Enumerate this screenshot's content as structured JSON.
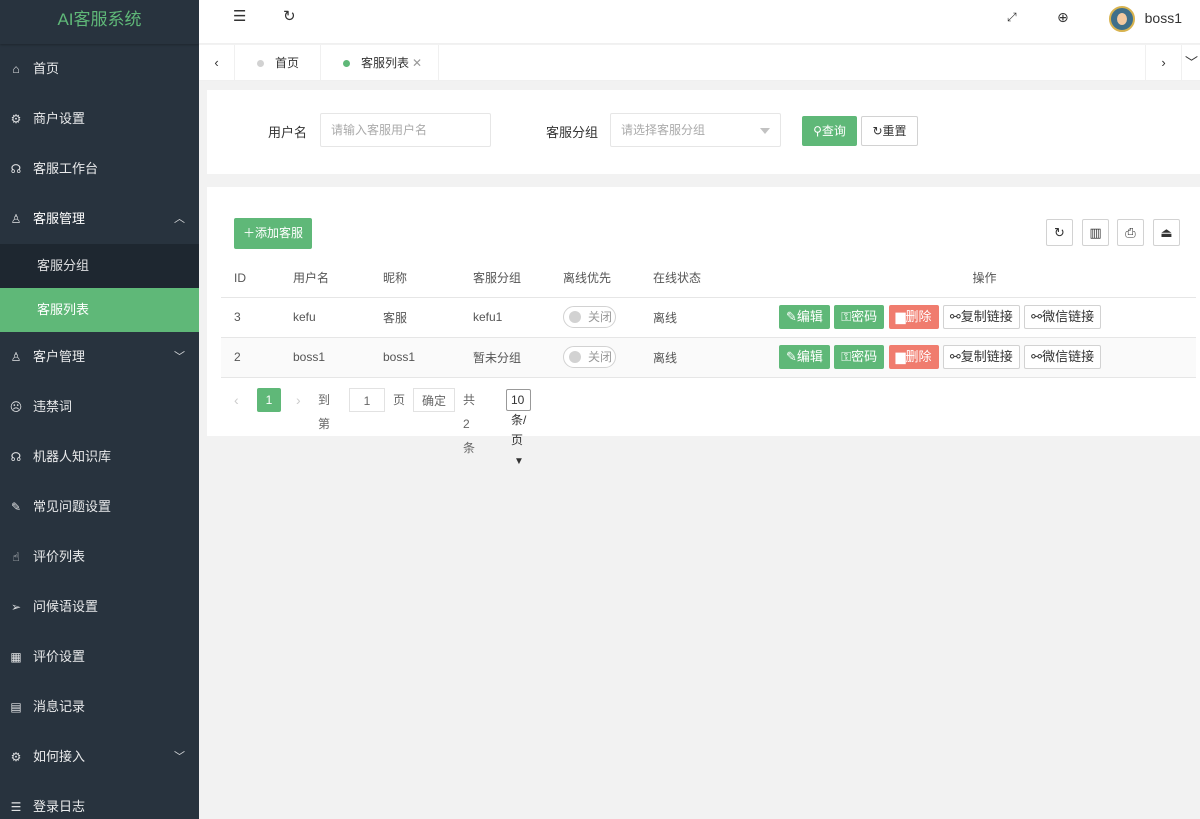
{
  "app": {
    "title": "AI客服系统"
  },
  "sidebar": {
    "items": [
      {
        "label": "首页",
        "icon": "home-icon"
      },
      {
        "label": "商户设置",
        "icon": "gear-icon"
      },
      {
        "label": "客服工作台",
        "icon": "headset-icon"
      },
      {
        "label": "客服管理",
        "icon": "user-icon"
      },
      {
        "label": "客户管理",
        "icon": "user-icon"
      },
      {
        "label": "违禁词",
        "icon": "sad-face-icon"
      },
      {
        "label": "机器人知识库",
        "icon": "headset-icon"
      },
      {
        "label": "常见问题设置",
        "icon": "edit-icon"
      },
      {
        "label": "评价列表",
        "icon": "thumb-up-icon"
      },
      {
        "label": "问候语设置",
        "icon": "send-icon"
      },
      {
        "label": "评价设置",
        "icon": "calendar-icon"
      },
      {
        "label": "消息记录",
        "icon": "document-icon"
      },
      {
        "label": "如何接入",
        "icon": "gear-icon"
      },
      {
        "label": "登录日志",
        "icon": "list-icon"
      }
    ],
    "submenu": [
      {
        "label": "客服分组"
      },
      {
        "label": "客服列表"
      }
    ]
  },
  "header": {
    "username": "boss1"
  },
  "tabs": [
    {
      "label": "首页"
    },
    {
      "label": "客服列表"
    }
  ],
  "search": {
    "username_label": "用户名",
    "username_placeholder": "请输入客服用户名",
    "group_label": "客服分组",
    "group_placeholder": "请选择客服分组",
    "query_button": "查询",
    "reset_button": "重置"
  },
  "table": {
    "add_button": "添加客服",
    "headers": [
      "ID",
      "用户名",
      "昵称",
      "客服分组",
      "离线优先",
      "在线状态",
      "操作"
    ],
    "rows": [
      {
        "id": "3",
        "username": "kefu",
        "nickname": "客服",
        "group": "kefu1",
        "offline_first": "关闭",
        "status": "离线"
      },
      {
        "id": "2",
        "username": "boss1",
        "nickname": "boss1",
        "group": "暂未分组",
        "offline_first": "关闭",
        "status": "离线"
      }
    ],
    "actions": {
      "edit": "编辑",
      "password": "密码",
      "delete": "删除",
      "copy_link": "复制链接",
      "wechat_link": "微信链接"
    }
  },
  "pagination": {
    "current_page": "1",
    "goto_label": "到第",
    "goto_value": "1",
    "page_unit": "页",
    "confirm": "确定",
    "total": "共 2 条",
    "page_size": "10 条/页"
  },
  "colors": {
    "accent": "#5fb878",
    "danger": "#f07c6e",
    "sidebar_bg": "#28333e"
  }
}
